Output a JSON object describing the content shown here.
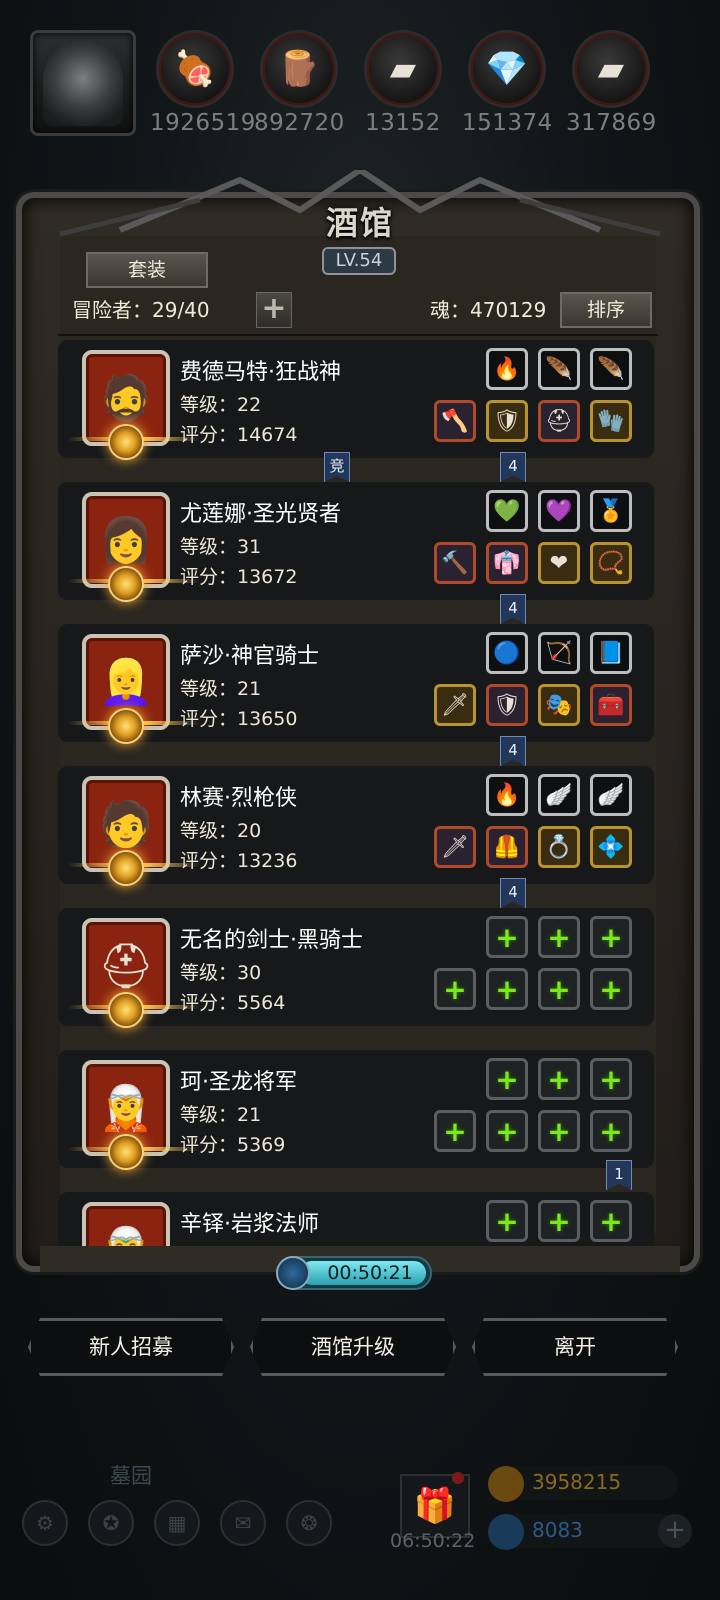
{
  "resources": [
    {
      "icon": "meat-icon",
      "glyph": "🍖",
      "value": "1926519"
    },
    {
      "icon": "wood-icon",
      "glyph": "🪵",
      "value": "892720"
    },
    {
      "icon": "iron-icon",
      "glyph": "▰",
      "value": "13152"
    },
    {
      "icon": "crystal-icon",
      "glyph": "💎",
      "value": "151374"
    },
    {
      "icon": "stone-icon",
      "glyph": "▰",
      "value": "317869"
    }
  ],
  "tavern": {
    "title": "酒馆",
    "level": "LV.54",
    "set_button": "套装",
    "adventurers": "冒险者：29/40",
    "soul": "魂：470129",
    "sort_button": "排序"
  },
  "heroes": [
    {
      "name": "费德马特·狂战神",
      "level": "等级：22",
      "score": "评分：14674",
      "portrait": "🧔"
    },
    {
      "name": "尤莲娜·圣光贤者",
      "level": "等级：31",
      "score": "评分：13672",
      "portrait": "👩"
    },
    {
      "name": "萨沙·神官骑士",
      "level": "等级：21",
      "score": "评分：13650",
      "portrait": "👱‍♀️"
    },
    {
      "name": "林赛·烈枪侠",
      "level": "等级：20",
      "score": "评分：13236",
      "portrait": "🧑"
    },
    {
      "name": "无名的剑士·黑骑士",
      "level": "等级：30",
      "score": "评分：5564",
      "portrait": "⛑"
    },
    {
      "name": "珂·圣龙将军",
      "level": "等级：21",
      "score": "评分：5369",
      "portrait": "🧝"
    },
    {
      "name": "辛铎·岩浆法师",
      "level": "",
      "score": "",
      "portrait": "🧝‍♂️"
    }
  ],
  "tags": {
    "compete": "竞",
    "four": "4",
    "one": "1"
  },
  "timer": "00:50:21",
  "buttons": {
    "recruit": "新人招募",
    "upgrade": "酒馆升级",
    "leave": "离开"
  },
  "footer": {
    "location": "墓园",
    "gift_timer": "06:50:22",
    "gold": "3958215",
    "gems": "8083"
  },
  "colors": {
    "gold_text": "#8a6a1a",
    "gem_text": "#2a5a8a",
    "plus_green": "#7ee81e"
  }
}
